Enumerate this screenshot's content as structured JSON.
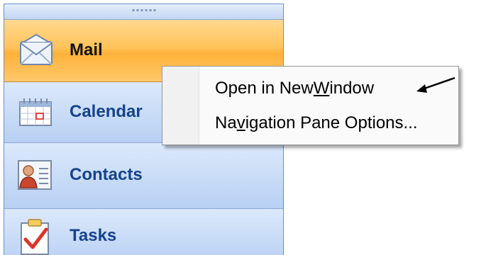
{
  "nav_pane": {
    "buttons": [
      {
        "label": "Mail",
        "icon": "envelope-icon",
        "selected": true
      },
      {
        "label": "Calendar",
        "icon": "calendar-icon",
        "selected": false
      },
      {
        "label": "Contacts",
        "icon": "contact-card-icon",
        "selected": false
      },
      {
        "label": "Tasks",
        "icon": "checkmark-clipboard-icon",
        "selected": false
      }
    ]
  },
  "context_menu": {
    "items": [
      {
        "pre": "Open in New ",
        "mnemonic": "W",
        "post": "indow"
      },
      {
        "pre": "Na",
        "mnemonic": "v",
        "post": "igation Pane Options..."
      }
    ]
  },
  "colors": {
    "selected_button": "#ffc35a",
    "nav_label": "#15428b",
    "pane_background": "#c6daf6"
  }
}
